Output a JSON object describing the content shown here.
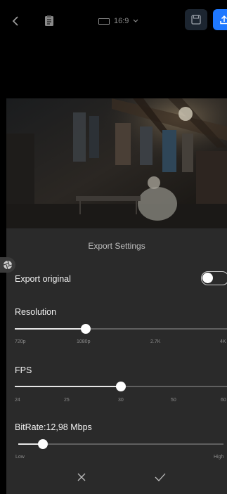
{
  "topbar": {
    "aspect_label": "16:9"
  },
  "panel": {
    "title": "Export Settings",
    "export_original": {
      "label": "Export original",
      "enabled": false
    },
    "resolution": {
      "label": "Resolution",
      "ticks": [
        "720p",
        "1080p",
        "2.7K",
        "4K"
      ],
      "selected": "1080p"
    },
    "fps": {
      "label": "FPS",
      "ticks": [
        "24",
        "25",
        "30",
        "50",
        "60"
      ],
      "selected": "30"
    },
    "bitrate": {
      "label": "BitRate:12,98 Mbps",
      "min_label": "Low",
      "max_label": "High",
      "level": 0.13
    }
  },
  "colors": {
    "accent": "#1e78ff",
    "panel_bg": "#2a2a2a",
    "track": "#5f5f5f"
  }
}
